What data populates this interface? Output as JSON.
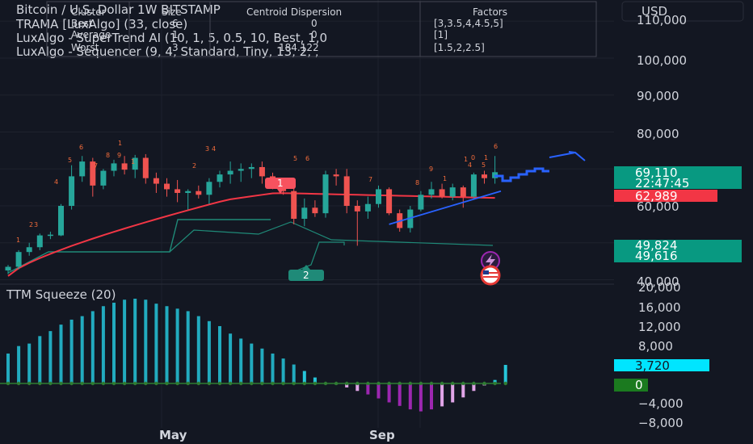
{
  "currency": "USD",
  "legend": {
    "symbol": "Bitcoin / U.S. Dollar 1W BITSTAMP",
    "ind1": "TRAMA [LuxAlgo] (33, close)",
    "ind2": "LuxAlgo - SuperTrend AI (10, 1, 5, 0.5, 10, Best, 1,0",
    "ind3": "LuxAlgo - Sequencer (9, 4, Standard, Tiny, 13, 2, ,"
  },
  "cluster_table": {
    "headers": [
      "Cluster",
      "Size",
      "Centroid Dispersion",
      "Factors"
    ],
    "rows": [
      [
        "Best",
        "6",
        "0",
        "[3,3.5,4,4.5,5]"
      ],
      [
        "Average",
        "1",
        "0",
        "[1]"
      ],
      [
        "Worst",
        "3",
        "184.122",
        "[1.5,2,2.5]"
      ]
    ]
  },
  "price_axis": {
    "ticks": [
      "110,000",
      "100,000",
      "90,000",
      "80,000",
      "60,000",
      "40,000"
    ]
  },
  "price_labels": {
    "last": "69,110",
    "countdown": "22:47:45",
    "trama": "62,989",
    "st1": "49,824",
    "st2": "49,616"
  },
  "oscillator": {
    "title": "TTM Squeeze (20)",
    "ticks": [
      "20,000",
      "16,000",
      "12,000",
      "8,000",
      "4,000",
      "−4,000",
      "−8,000"
    ],
    "last_value": "3,720",
    "zero_label": "0"
  },
  "time_axis": {
    "labels": [
      "May",
      "Sep"
    ]
  },
  "markers": {
    "top_box": "1",
    "bottom_box": "2"
  },
  "colors": {
    "up": "#26a69a",
    "down": "#ef5350",
    "trama": "#f23645",
    "supertrend": "#1f8a78",
    "projection": "#2962ff",
    "sequencer": "#f36c3b",
    "osc_teal": "#26c6da",
    "osc_pink": "#e1a5e8",
    "osc_purple": "#9c27b0",
    "zero_dot": "#2e7d32"
  },
  "chart_data": [
    {
      "type": "candlestick",
      "title": "Bitcoin / U.S. Dollar 1W BITSTAMP",
      "ylabel": "USD",
      "ylim": [
        38500,
        118000
      ],
      "x_labels": [
        "May",
        "Sep"
      ],
      "candles": [
        {
          "o": 42500,
          "h": 44000,
          "l": 41500,
          "c": 43500
        },
        {
          "o": 43500,
          "h": 48000,
          "l": 42800,
          "c": 47500
        },
        {
          "o": 47500,
          "h": 50000,
          "l": 46500,
          "c": 48800
        },
        {
          "o": 48800,
          "h": 52500,
          "l": 48000,
          "c": 52000
        },
        {
          "o": 52000,
          "h": 53000,
          "l": 51000,
          "c": 52200
        },
        {
          "o": 52000,
          "h": 60500,
          "l": 51800,
          "c": 60000
        },
        {
          "o": 60000,
          "h": 71000,
          "l": 59000,
          "c": 68000
        },
        {
          "o": 68000,
          "h": 73500,
          "l": 66500,
          "c": 72000
        },
        {
          "o": 72000,
          "h": 73000,
          "l": 62500,
          "c": 65500
        },
        {
          "o": 65500,
          "h": 70000,
          "l": 64500,
          "c": 69500
        },
        {
          "o": 69500,
          "h": 72500,
          "l": 68000,
          "c": 71500
        },
        {
          "o": 71500,
          "h": 73500,
          "l": 68500,
          "c": 69800
        },
        {
          "o": 69800,
          "h": 73800,
          "l": 67500,
          "c": 73000
        },
        {
          "o": 73000,
          "h": 74000,
          "l": 66000,
          "c": 67500
        },
        {
          "o": 67500,
          "h": 69000,
          "l": 63500,
          "c": 66000
        },
        {
          "o": 66000,
          "h": 67500,
          "l": 62500,
          "c": 64500
        },
        {
          "o": 64500,
          "h": 67000,
          "l": 61000,
          "c": 63500
        },
        {
          "o": 63500,
          "h": 64500,
          "l": 59000,
          "c": 64000
        },
        {
          "o": 64000,
          "h": 65500,
          "l": 62000,
          "c": 63000
        },
        {
          "o": 63000,
          "h": 67500,
          "l": 60500,
          "c": 66500
        },
        {
          "o": 66500,
          "h": 69500,
          "l": 65000,
          "c": 68500
        },
        {
          "o": 68500,
          "h": 72000,
          "l": 66000,
          "c": 69500
        },
        {
          "o": 69500,
          "h": 71500,
          "l": 66500,
          "c": 70000
        },
        {
          "o": 70000,
          "h": 71500,
          "l": 67500,
          "c": 70500
        },
        {
          "o": 70500,
          "h": 72000,
          "l": 66000,
          "c": 68000
        },
        {
          "o": 68000,
          "h": 69000,
          "l": 64500,
          "c": 66000
        },
        {
          "o": 66000,
          "h": 67000,
          "l": 63000,
          "c": 64000
        },
        {
          "o": 64000,
          "h": 65000,
          "l": 55000,
          "c": 56500
        },
        {
          "o": 56500,
          "h": 62000,
          "l": 54500,
          "c": 59500
        },
        {
          "o": 59500,
          "h": 61500,
          "l": 57000,
          "c": 58000
        },
        {
          "o": 58000,
          "h": 69500,
          "l": 56800,
          "c": 68500
        },
        {
          "o": 68500,
          "h": 70000,
          "l": 65500,
          "c": 68000
        },
        {
          "o": 68000,
          "h": 70000,
          "l": 58000,
          "c": 60000
        },
        {
          "o": 60000,
          "h": 61500,
          "l": 49200,
          "c": 58500
        },
        {
          "o": 58500,
          "h": 62500,
          "l": 56500,
          "c": 60500
        },
        {
          "o": 60500,
          "h": 65500,
          "l": 59500,
          "c": 64500
        },
        {
          "o": 64500,
          "h": 65000,
          "l": 57500,
          "c": 58000
        },
        {
          "o": 58000,
          "h": 59000,
          "l": 53000,
          "c": 54000
        },
        {
          "o": 54000,
          "h": 60000,
          "l": 52800,
          "c": 59000
        },
        {
          "o": 59000,
          "h": 64000,
          "l": 58500,
          "c": 63000
        },
        {
          "o": 63000,
          "h": 66500,
          "l": 62000,
          "c": 64500
        },
        {
          "o": 64500,
          "h": 66000,
          "l": 62000,
          "c": 62500
        },
        {
          "o": 62500,
          "h": 66000,
          "l": 61500,
          "c": 65000
        },
        {
          "o": 65000,
          "h": 65500,
          "l": 59500,
          "c": 62500
        },
        {
          "o": 62500,
          "h": 69000,
          "l": 62000,
          "c": 68500
        },
        {
          "o": 68500,
          "h": 69500,
          "l": 66000,
          "c": 67500
        },
        {
          "o": 67500,
          "h": 73500,
          "l": 66000,
          "c": 69110
        }
      ],
      "series": [
        {
          "name": "TRAMA",
          "values": [
            null,
            null,
            null,
            null,
            null,
            null,
            null,
            null,
            null,
            null,
            null,
            null,
            null,
            null,
            null,
            null,
            null,
            null,
            null,
            null,
            null,
            null,
            null,
            null,
            null,
            null,
            null,
            null,
            null,
            null,
            null,
            null,
            null,
            null,
            null,
            null,
            null,
            null,
            null,
            null,
            null,
            null,
            null,
            null,
            null,
            null,
            62989
          ]
        }
      ],
      "projection": {
        "x": [
          38,
          54
        ],
        "y": [
          55000,
          76500
        ]
      }
    },
    {
      "type": "bar",
      "title": "TTM Squeeze (20)",
      "ylim": [
        -9500,
        20500
      ],
      "values": [
        6000,
        7500,
        8000,
        9500,
        10500,
        11800,
        12800,
        13500,
        14500,
        15500,
        16200,
        16800,
        17000,
        16800,
        16000,
        15500,
        15000,
        14500,
        13500,
        12500,
        11500,
        10000,
        9000,
        8000,
        7000,
        6000,
        5000,
        3800,
        2500,
        1200,
        0,
        -200,
        -800,
        -1500,
        -2200,
        -3000,
        -3800,
        -4500,
        -5200,
        -5600,
        -5200,
        -4600,
        -3800,
        -2800,
        -1500,
        -400,
        700,
        3720
      ]
    }
  ]
}
